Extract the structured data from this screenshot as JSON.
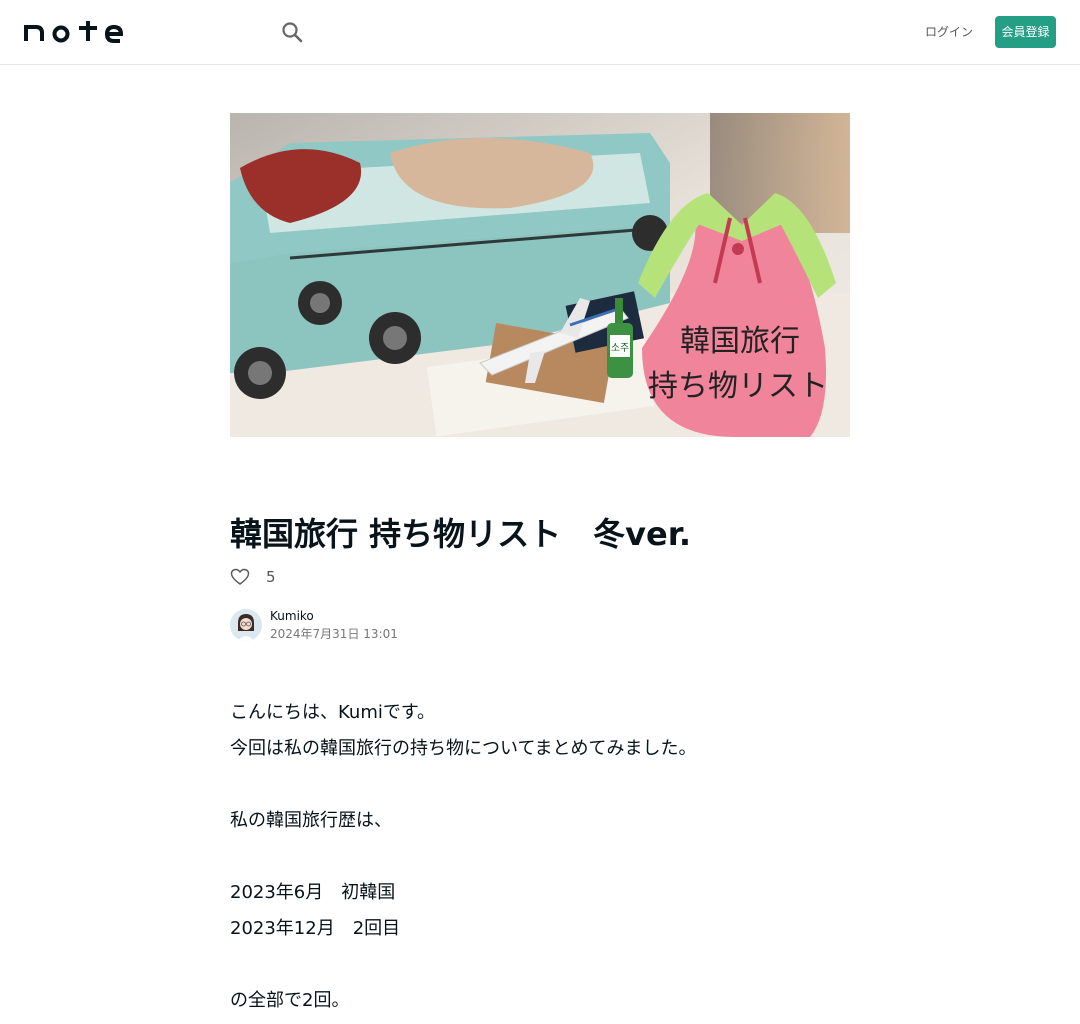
{
  "header": {
    "logo_text": "note",
    "login_label": "ログイン",
    "signup_label": "会員登録"
  },
  "hero": {
    "overlay_line1": "韓国旅行",
    "overlay_line2": "持ち物リスト",
    "bottle_label": "소주"
  },
  "article": {
    "title": "韓国旅行 持ち物リスト　冬ver.",
    "like_count": "5",
    "author_name": "Kumiko",
    "date": "2024年7月31日 13:01",
    "body": [
      "こんにちは、Kumiです。",
      "今回は私の韓国旅行の持ち物についてまとめてみました。",
      "",
      "私の韓国旅行歴は、",
      "",
      "2023年6月　初韓国",
      "2023年12月　2回目",
      "",
      "の全部で2回。"
    ]
  },
  "colors": {
    "accent": "#249e85",
    "text": "#08131a",
    "hanbok_pink": "#f0849a",
    "hanbok_green": "#b6e27a"
  }
}
